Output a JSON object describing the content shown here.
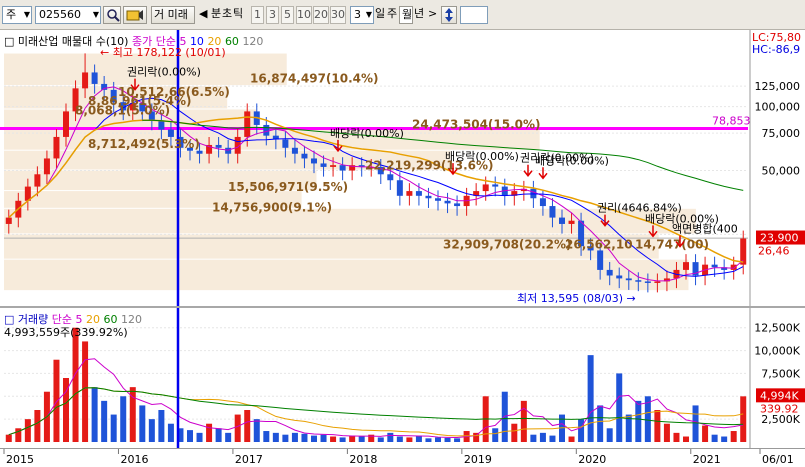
{
  "toolbar": {
    "market": "주",
    "code": "025560",
    "search_icon": "magnifier-icon",
    "refresh_icon": "refresh-icon",
    "name_prefix": "거",
    "name": "미래",
    "prev_button": "◀",
    "tabs": [
      "분",
      "초",
      "틱"
    ],
    "periods": [
      "1",
      "3",
      "5",
      "10",
      "20",
      "30"
    ],
    "count_value": "3",
    "intervals": [
      "일",
      "주",
      "월",
      "년"
    ],
    "active_interval": "월",
    "next_button": ">",
    "updown_icon": "up-down-arrows-icon"
  },
  "price_panel": {
    "title_marker": "□",
    "title": "미래산업 매물대 수(10)",
    "legend_ma": "종가 단순",
    "ma_periods": [
      "5",
      "10",
      "20",
      "60",
      "120"
    ],
    "ma_colors": [
      "#cc00cc",
      "#0000ff",
      "#e8a000",
      "#008000",
      "#808080"
    ],
    "y_ticks": [
      "125,000",
      "100,000",
      "75,000",
      "50,000",
      "25,000"
    ],
    "lc_label": "LC:75,80",
    "hc_label": "HC:-86,9",
    "max_label": "최고 178,122 (10/01)",
    "min_label": "최저 13,595 (08/03)",
    "current_price": "23,900",
    "current_pct": "26,46",
    "magenta_value": "78,853",
    "volume_profile": [
      {
        "label": "16,874,497(10.4%)"
      },
      {
        "label": "24,473,504(15.0%)"
      },
      {
        "label": "22,219,299(13.6%)"
      },
      {
        "label": "15,506,971(9.5%)"
      },
      {
        "label": "14,756,900(9.1%)"
      },
      {
        "label": "32,909,708(20.2%)"
      },
      {
        "label": "26,562,10"
      },
      {
        "label": "14,747(00)"
      }
    ],
    "profile_left": [
      {
        "label": "10,512,66(6.5%)"
      },
      {
        "label": "8,86,961(5.4%)"
      },
      {
        "label": "8,068,1(5.0%)"
      },
      {
        "label": "8,712,492(5.3%)"
      }
    ],
    "events": [
      {
        "label": "권리락(0.00%)"
      },
      {
        "label": "배당락(0.00%)"
      },
      {
        "label": "배당락(0.00%)"
      },
      {
        "label": "권리락(0.00%)"
      },
      {
        "label": "배당락(0.00%)"
      },
      {
        "label": "권리(4646.84%)"
      },
      {
        "label": "배당락(0.00%)"
      },
      {
        "label": "액면병합(400"
      }
    ]
  },
  "volume_panel": {
    "title": "거래량",
    "legend_ma": "단순",
    "ma_periods": [
      "5",
      "20",
      "60",
      "120"
    ],
    "info": "4,993,559주(339.92%)",
    "y_ticks": [
      "12,500K",
      "10,000K",
      "7,500K",
      "5,000K",
      "2,500K"
    ],
    "current_volume": "4,994K",
    "current_pct": "339.92"
  },
  "date_axis": [
    "2015",
    "2016",
    "2017",
    "2018",
    "2019",
    "2020",
    "2021",
    "06/01"
  ],
  "chart_data": {
    "type": "candlestick",
    "interval": "monthly",
    "y_range": [
      12000,
      185000
    ],
    "max": 178122,
    "min": 13595,
    "horizontal_line": 78853,
    "volume_y_range": [
      0,
      14000000
    ],
    "closes": [
      30000,
      36000,
      42000,
      48000,
      57000,
      72000,
      95000,
      122000,
      145000,
      128000,
      120000,
      105000,
      96000,
      104000,
      95000,
      86000,
      78000,
      72000,
      64000,
      62000,
      60000,
      66000,
      64000,
      60000,
      72000,
      95000,
      82000,
      73000,
      70000,
      64000,
      60000,
      57000,
      54000,
      52000,
      53000,
      50000,
      53000,
      52000,
      52000,
      48000,
      45000,
      38000,
      40000,
      38000,
      37000,
      36000,
      35000,
      34000,
      38000,
      40000,
      43000,
      42000,
      38000,
      40000,
      41000,
      37000,
      34000,
      30000,
      28000,
      29000,
      22000,
      21000,
      17000,
      16000,
      15500,
      15200,
      15000,
      14800,
      15000,
      15500,
      17000,
      18500,
      16000,
      18000,
      17500,
      17000,
      18000,
      23900
    ],
    "volumes": [
      800000,
      1500000,
      2500000,
      3500000,
      5500000,
      9000000,
      7000000,
      12500000,
      11000000,
      6000000,
      4500000,
      3000000,
      5000000,
      6000000,
      4000000,
      2500000,
      3500000,
      2000000,
      1500000,
      1300000,
      1000000,
      2000000,
      1500000,
      1000000,
      3000000,
      3500000,
      2500000,
      1200000,
      1000000,
      800000,
      1000000,
      900000,
      700000,
      800000,
      600000,
      500000,
      700000,
      600000,
      800000,
      500000,
      1000000,
      600000,
      500000,
      700000,
      400000,
      500000,
      450000,
      400000,
      1200000,
      1000000,
      5000000,
      1500000,
      5500000,
      2000000,
      4500000,
      800000,
      1000000,
      700000,
      3000000,
      600000,
      2500000,
      9500000,
      4000000,
      1500000,
      7500000,
      3000000,
      4500000,
      5000000,
      3500000,
      2000000,
      1000000,
      600000,
      4000000,
      1800000,
      800000,
      600000,
      1200000,
      4993559
    ]
  }
}
